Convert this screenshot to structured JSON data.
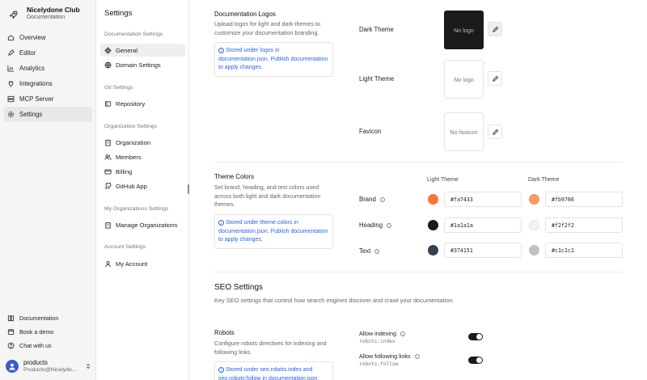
{
  "app": {
    "name": "Nicelydone Club",
    "subtitle": "Documentation"
  },
  "nav": [
    {
      "label": "Overview",
      "icon": "home-icon"
    },
    {
      "label": "Editor",
      "icon": "edit-icon"
    },
    {
      "label": "Analytics",
      "icon": "chart-icon"
    },
    {
      "label": "Integrations",
      "icon": "plug-icon"
    },
    {
      "label": "MCP Server",
      "icon": "server-icon"
    },
    {
      "label": "Settings",
      "icon": "gear-icon",
      "active": true
    }
  ],
  "bottom_links": [
    {
      "label": "Documentation",
      "icon": "book-icon"
    },
    {
      "label": "Book a demo",
      "icon": "calendar-icon"
    },
    {
      "label": "Chat with us",
      "icon": "help-icon"
    }
  ],
  "user": {
    "name": "products",
    "email": "Products@Nicelydo..."
  },
  "settings_nav": {
    "title": "Settings",
    "groups": [
      {
        "label": "Documentation Settings",
        "items": [
          "General",
          "Domain Settings"
        ]
      },
      {
        "label": "Git Settings",
        "items": [
          "Repository"
        ]
      },
      {
        "label": "Organization Settings",
        "items": [
          "Organization",
          "Members",
          "Billing",
          "GitHub App"
        ]
      },
      {
        "label": "My Organizations Settings",
        "items": [
          "Manage Organizations"
        ]
      },
      {
        "label": "Account Settings",
        "items": [
          "My Account"
        ]
      }
    ]
  },
  "logos": {
    "title": "Documentation Logos",
    "description": "Upload logos for light and dark themes to customize your documentation branding.",
    "info": "Stored under logos in documentation.json. Publish documentation to apply changes.",
    "rows": [
      {
        "label": "Dark Theme",
        "placeholder": "No logo"
      },
      {
        "label": "Light Theme",
        "placeholder": "No logo"
      },
      {
        "label": "Favicon",
        "placeholder": "No favicon"
      }
    ]
  },
  "colors": {
    "title": "Theme Colors",
    "description": "Set brand, heading, and text colors used across both light and dark documentation themes.",
    "info": "Stored under theme.colors in documentation.json. Publish documentation to apply changes.",
    "light_header": "Light Theme",
    "dark_header": "Dark Theme",
    "rows": [
      {
        "label": "Brand",
        "light": "#fa7433",
        "dark": "#fb9766"
      },
      {
        "label": "Heading",
        "light": "#1a1a1a",
        "dark": "#f2f2f2"
      },
      {
        "label": "Text",
        "light": "#374151",
        "dark": "#c1c1c1"
      }
    ]
  },
  "seo": {
    "title": "SEO Settings",
    "description": "Key SEO settings that control how search engines discover and crawl your documentation.",
    "robots": {
      "title": "Robots",
      "description": "Configure robots directives for indexing and following links.",
      "info": "Stored under seo.robots.index and seo.robots:follow in documentation.json.",
      "toggles": [
        {
          "label": "Allow indexing",
          "code": "robots:index",
          "on": true
        },
        {
          "label": "Allow following links",
          "code": "robots:follow",
          "on": true
        }
      ]
    }
  }
}
